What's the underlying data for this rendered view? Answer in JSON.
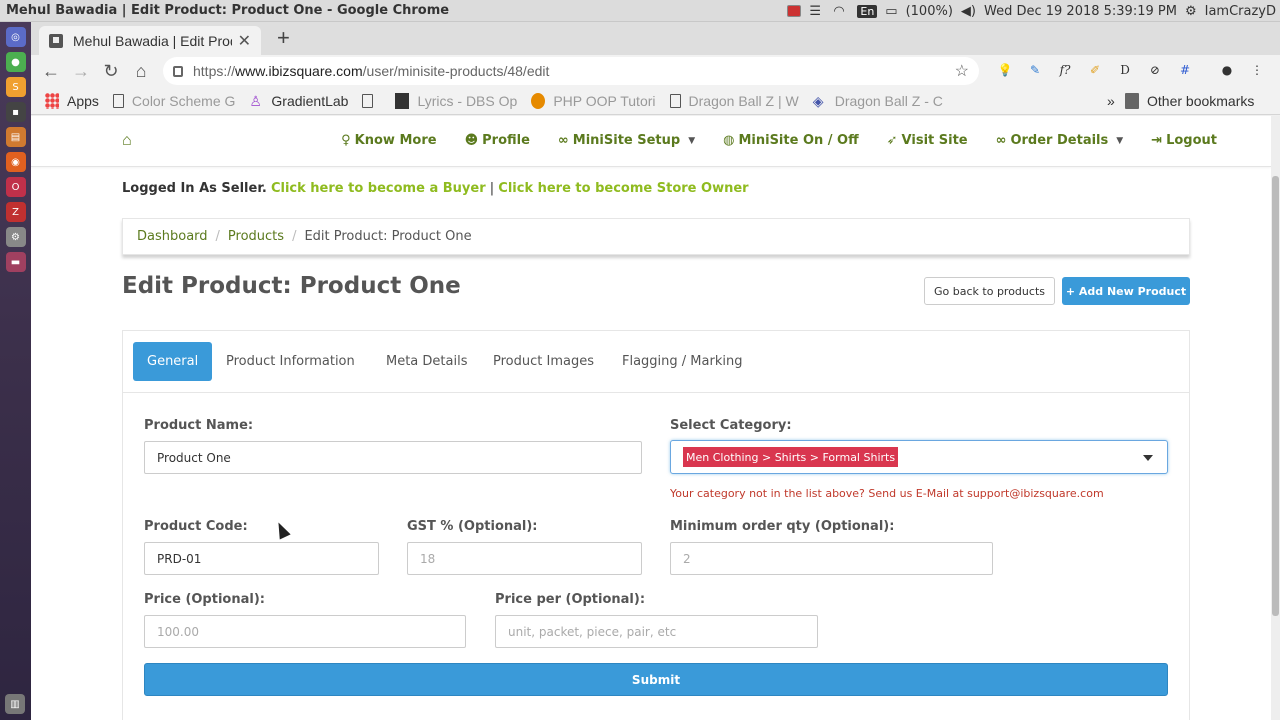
{
  "os": {
    "window_title": "Mehul Bawadia | Edit Product: Product One - Google Chrome",
    "lang": "En",
    "battery": "(100%)",
    "datetime": "Wed Dec 19 2018  5:39:19 PM",
    "user": "IamCrazyD"
  },
  "browser": {
    "tab_title": "Mehul Bawadia | Edit Prod",
    "url_prefix": "https://",
    "url_domain": "www.ibizsquare.com",
    "url_path": "/user/minisite-products/48/edit",
    "bookmarks": [
      {
        "label": "Apps"
      },
      {
        "label": "Color Scheme G"
      },
      {
        "label": "GradientLab"
      },
      {
        "label": ""
      },
      {
        "label": "Lyrics - DBS Op"
      },
      {
        "label": "PHP OOP Tutori"
      },
      {
        "label": "Dragon Ball Z | W"
      },
      {
        "label": "Dragon Ball Z - C"
      }
    ],
    "overflow": "»",
    "other_bookmarks": "Other bookmarks"
  },
  "nav": {
    "items": [
      {
        "label": "Know More",
        "icon": "lightbulb-icon"
      },
      {
        "label": "Profile",
        "icon": "user-icon"
      },
      {
        "label": "MiniSite Setup",
        "icon": "link-icon",
        "dropdown": true
      },
      {
        "label": "MiniSite On / Off",
        "icon": "globe-icon"
      },
      {
        "label": "Visit Site",
        "icon": "rocket-icon"
      },
      {
        "label": "Order Details",
        "icon": "link-icon",
        "dropdown": true
      },
      {
        "label": "Logout",
        "icon": "sign-out-icon"
      }
    ]
  },
  "session": {
    "logged_label": "Logged In As Seller.",
    "buyer_link": "Click here to become a Buyer",
    "separator": "|",
    "owner_link": "Click here to become Store Owner"
  },
  "breadcrumb": {
    "items": [
      "Dashboard",
      "Products"
    ],
    "current": "Edit Product: Product One"
  },
  "page": {
    "title": "Edit Product: Product One",
    "back_button": "Go back to products",
    "add_button": "+ Add New Product"
  },
  "tabs": [
    {
      "label": "General",
      "active": true
    },
    {
      "label": "Product Information"
    },
    {
      "label": "Meta Details"
    },
    {
      "label": "Product Images"
    },
    {
      "label": "Flagging / Marking"
    }
  ],
  "form": {
    "product_name": {
      "label": "Product Name:",
      "value": "Product One"
    },
    "category": {
      "label": "Select Category:",
      "selected": "Men Clothing > Shirts > Formal Shirts",
      "help": "Your category not in the list above? Send us E-Mail at support@ibizsquare.com"
    },
    "product_code": {
      "label": "Product Code:",
      "value": "PRD-01"
    },
    "gst": {
      "label": "GST % (Optional):",
      "placeholder": "18"
    },
    "min_qty": {
      "label": "Minimum order qty (Optional):",
      "placeholder": "2"
    },
    "price": {
      "label": "Price (Optional):",
      "placeholder": "100.00"
    },
    "price_per": {
      "label": "Price per (Optional):",
      "placeholder": "unit, packet, piece, pair, etc"
    },
    "submit": "Submit"
  },
  "colors": {
    "brand_green": "#5b7a1e",
    "link_green": "#8fbb1f",
    "primary_blue": "#3a9ad9",
    "chip_red": "#d9364f",
    "help_red": "#c0392b"
  }
}
